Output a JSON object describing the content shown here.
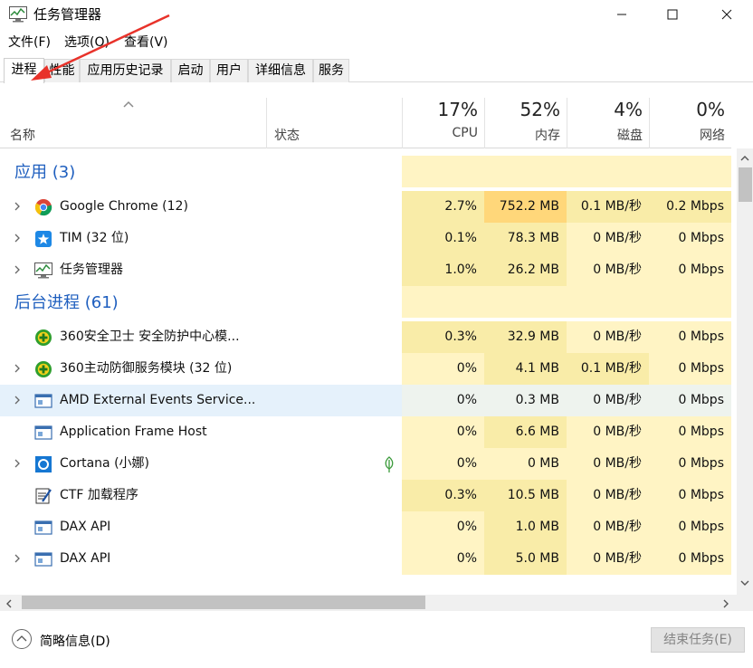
{
  "window": {
    "title": "任务管理器"
  },
  "menu": [
    {
      "label": "文件(F)"
    },
    {
      "label": "选项(O)"
    },
    {
      "label": "查看(V)"
    }
  ],
  "tabs": [
    {
      "label": "进程",
      "active": true
    },
    {
      "label": "性能"
    },
    {
      "label": "应用历史记录"
    },
    {
      "label": "启动"
    },
    {
      "label": "用户"
    },
    {
      "label": "详细信息"
    },
    {
      "label": "服务"
    }
  ],
  "header": {
    "name": "名称",
    "status": "状态",
    "cpu": {
      "pct": "17%",
      "label": "CPU"
    },
    "memory": {
      "pct": "52%",
      "label": "内存"
    },
    "disk": {
      "pct": "4%",
      "label": "磁盘"
    },
    "network": {
      "pct": "0%",
      "label": "网络"
    }
  },
  "rows": [
    {
      "type": "group",
      "label": "应用 (3)"
    },
    {
      "type": "proc",
      "name": "Google Chrome (12)",
      "icon": "chrome-icon",
      "expandable": true,
      "cpu": "2.7%",
      "mem": "752.2 MB",
      "disk": "0.1 MB/秒",
      "net": "0.2 Mbps",
      "mem_heat": "high"
    },
    {
      "type": "proc",
      "name": "TIM (32 位)",
      "icon": "tim-icon",
      "expandable": true,
      "cpu": "0.1%",
      "mem": "78.3 MB",
      "disk": "0 MB/秒",
      "net": "0 Mbps"
    },
    {
      "type": "proc",
      "name": "任务管理器",
      "icon": "task-manager-icon",
      "expandable": true,
      "cpu": "1.0%",
      "mem": "26.2 MB",
      "disk": "0 MB/秒",
      "net": "0 Mbps"
    },
    {
      "type": "group",
      "label": "后台进程 (61)"
    },
    {
      "type": "proc",
      "name": "360安全卫士 安全防护中心模...",
      "icon": "360-icon",
      "expandable": false,
      "cpu": "0.3%",
      "mem": "32.9 MB",
      "disk": "0 MB/秒",
      "net": "0 Mbps"
    },
    {
      "type": "proc",
      "name": "360主动防御服务模块 (32 位)",
      "icon": "360-icon",
      "expandable": true,
      "cpu": "0%",
      "mem": "4.1 MB",
      "disk": "0.1 MB/秒",
      "net": "0 Mbps"
    },
    {
      "type": "proc",
      "name": "AMD External Events Service...",
      "icon": "service-icon",
      "expandable": true,
      "selected": true,
      "cpu": "0%",
      "mem": "0.3 MB",
      "disk": "0 MB/秒",
      "net": "0 Mbps"
    },
    {
      "type": "proc",
      "name": "Application Frame Host",
      "icon": "service-icon",
      "expandable": false,
      "cpu": "0%",
      "mem": "6.6 MB",
      "disk": "0 MB/秒",
      "net": "0 Mbps"
    },
    {
      "type": "proc",
      "name": "Cortana (小娜)",
      "icon": "cortana-icon",
      "expandable": true,
      "leaf": true,
      "cpu": "0%",
      "mem": "0 MB",
      "disk": "0 MB/秒",
      "net": "0 Mbps"
    },
    {
      "type": "proc",
      "name": "CTF 加载程序",
      "icon": "ctf-icon",
      "expandable": false,
      "cpu": "0.3%",
      "mem": "10.5 MB",
      "disk": "0 MB/秒",
      "net": "0 Mbps"
    },
    {
      "type": "proc",
      "name": "DAX API",
      "icon": "service-icon",
      "expandable": false,
      "cpu": "0%",
      "mem": "1.0 MB",
      "disk": "0 MB/秒",
      "net": "0 Mbps"
    },
    {
      "type": "proc",
      "name": "DAX API",
      "icon": "service-icon",
      "expandable": true,
      "cpu": "0%",
      "mem": "5.0 MB",
      "disk": "0 MB/秒",
      "net": "0 Mbps"
    }
  ],
  "footer": {
    "fewer_details": "简略信息(D)",
    "end_task": "结束任务(E)"
  },
  "colors": {
    "heat_low": "#fff4c4",
    "heat_mid": "#f9eca8",
    "heat_high": "#ffd77a",
    "group": "#1f5fbf",
    "selected": "#e5f1fb",
    "annotation_arrow": "#e8322a"
  }
}
